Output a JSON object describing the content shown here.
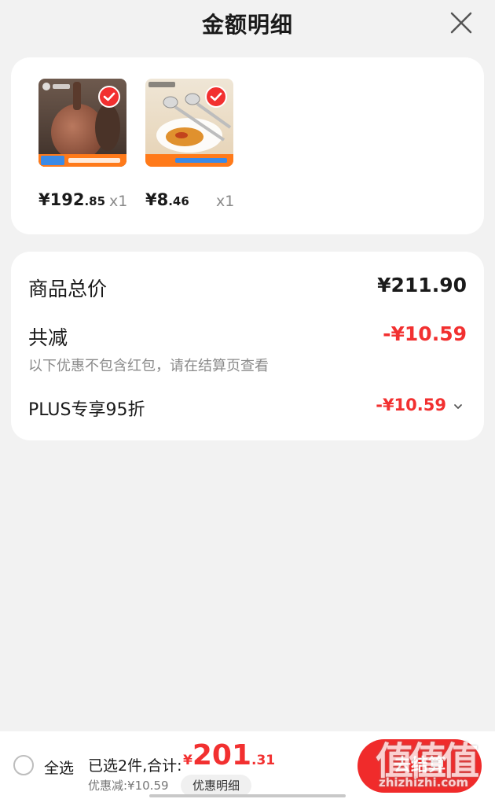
{
  "header": {
    "title": "金额明细"
  },
  "products": [
    {
      "price_main": "¥192",
      "price_decimal": ".85",
      "quantity": "x1",
      "thumb_icon": "product-pot-image"
    },
    {
      "price_main": "¥8",
      "price_decimal": ".46",
      "quantity": "x1",
      "thumb_icon": "product-spoon-image"
    }
  ],
  "summary": {
    "total_label": "商品总价",
    "total_value": "¥211.90",
    "reduction_label": "共减",
    "reduction_value": "-¥10.59",
    "reduction_note": "以下优惠不包含红包，请在结算页查看",
    "plus_label": "PLUS专享95折",
    "plus_value": "-¥10.59"
  },
  "bottom": {
    "select_all": "全选",
    "selected_text": "已选2件,合计:",
    "total_symbol": "¥",
    "total_main": "201",
    "total_decimal": ".31",
    "discount_text": "优惠减:¥10.59",
    "detail_button": "优惠明细",
    "checkout_button": "去结算"
  },
  "watermark": {
    "big": "值值值",
    "small": "zhizhizhi.com"
  },
  "colors": {
    "accent": "#f23030",
    "background": "#f2f2f2",
    "card": "#ffffff",
    "muted": "#8a8a8a"
  }
}
